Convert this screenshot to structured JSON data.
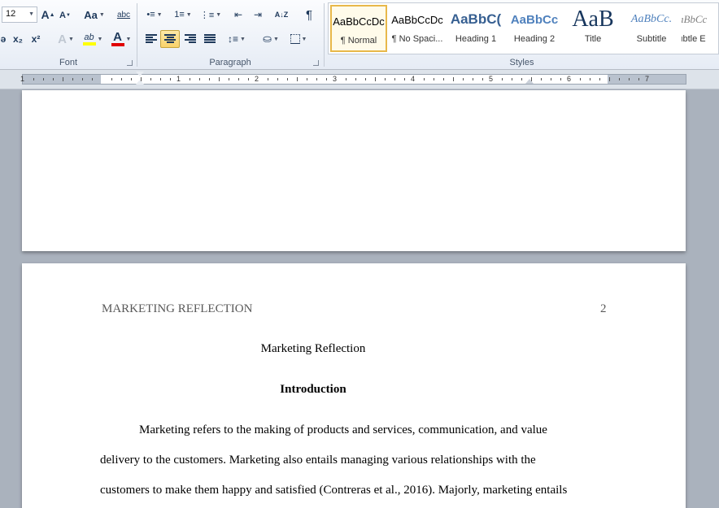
{
  "ribbon": {
    "font_group": {
      "label": "Font",
      "font_size": "12",
      "grow_font": "A",
      "shrink_font": "A",
      "change_case": "Aa",
      "strike": "abc",
      "subscript": "x₂",
      "superscript": "x²",
      "text_effects": "A",
      "highlight": "ab",
      "font_color": "A",
      "highlight_color": "#ffff00",
      "font_color_value": "#e00000"
    },
    "paragraph_group": {
      "label": "Paragraph",
      "sort": "A↓Z",
      "pilcrow": "¶"
    },
    "styles_group": {
      "label": "Styles",
      "items": [
        {
          "preview": "AaBbCcDc",
          "name": "¶ Normal"
        },
        {
          "preview": "AaBbCcDc",
          "name": "¶ No Spaci..."
        },
        {
          "preview": "AaBbC(",
          "name": "Heading 1"
        },
        {
          "preview": "AaBbCc",
          "name": "Heading 2"
        },
        {
          "preview": "AaB",
          "name": "Title"
        },
        {
          "preview": "AaBbCc.",
          "name": "Subtitle"
        },
        {
          "preview": "AaBbCc",
          "name": "Subtle E"
        }
      ]
    }
  },
  "ruler": {
    "numbers": [
      "1",
      "1",
      "2",
      "3",
      "4",
      "5",
      "6",
      "7"
    ]
  },
  "document": {
    "running_header": "MARKETING REFLECTION",
    "page_number": "2",
    "title": "Marketing Reflection",
    "heading": "Introduction",
    "lines": [
      "Marketing refers to the making of products and services, communication, and value",
      "delivery to the customers. Marketing also entails managing various relationships with the",
      "customers to make them happy and satisfied (Contreras et al., 2016). Majorly, marketing entails"
    ]
  }
}
